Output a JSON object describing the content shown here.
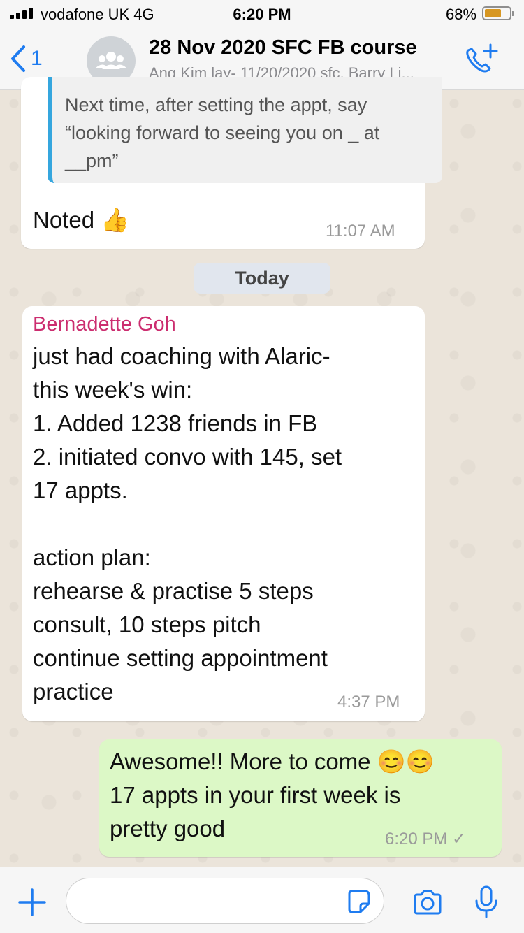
{
  "status_bar": {
    "carrier": "vodafone UK  4G",
    "time": "6:20 PM",
    "battery_pct": "68%",
    "battery_level": 0.68
  },
  "header": {
    "back_count": "1",
    "title": "28 Nov 2020 SFC FB course",
    "subtitle": "Ang Kim lay- 11/20/2020 sfc, Barry Li..."
  },
  "messages": {
    "m1": {
      "quoted_text": "Next time, after setting the appt, say\n“looking forward to seeing you on _ at\n__pm”",
      "text": "Noted 👍",
      "time": "11:07 AM"
    },
    "date_separator": "Today",
    "m2": {
      "sender": "Bernadette Goh",
      "text": "just had coaching with Alaric-\nthis week's win:\n1. Added 1238 friends in FB\n2. initiated convo with 145, set\n17 appts.\n\naction plan:\nrehearse & practise 5 steps\nconsult, 10 steps pitch\ncontinue setting appointment\npractice",
      "time": "4:37 PM"
    },
    "m3": {
      "text": "Awesome!! More to come 😊😊\n17 appts in your first week is\npretty good",
      "time": "6:20 PM ✓"
    }
  },
  "composer": {
    "placeholder": ""
  },
  "colors": {
    "accent": "#1f7cf0",
    "sender_name": "#cc2d6f",
    "outgoing_bubble": "#dcf8c6",
    "quote_bar": "#35a6de"
  }
}
